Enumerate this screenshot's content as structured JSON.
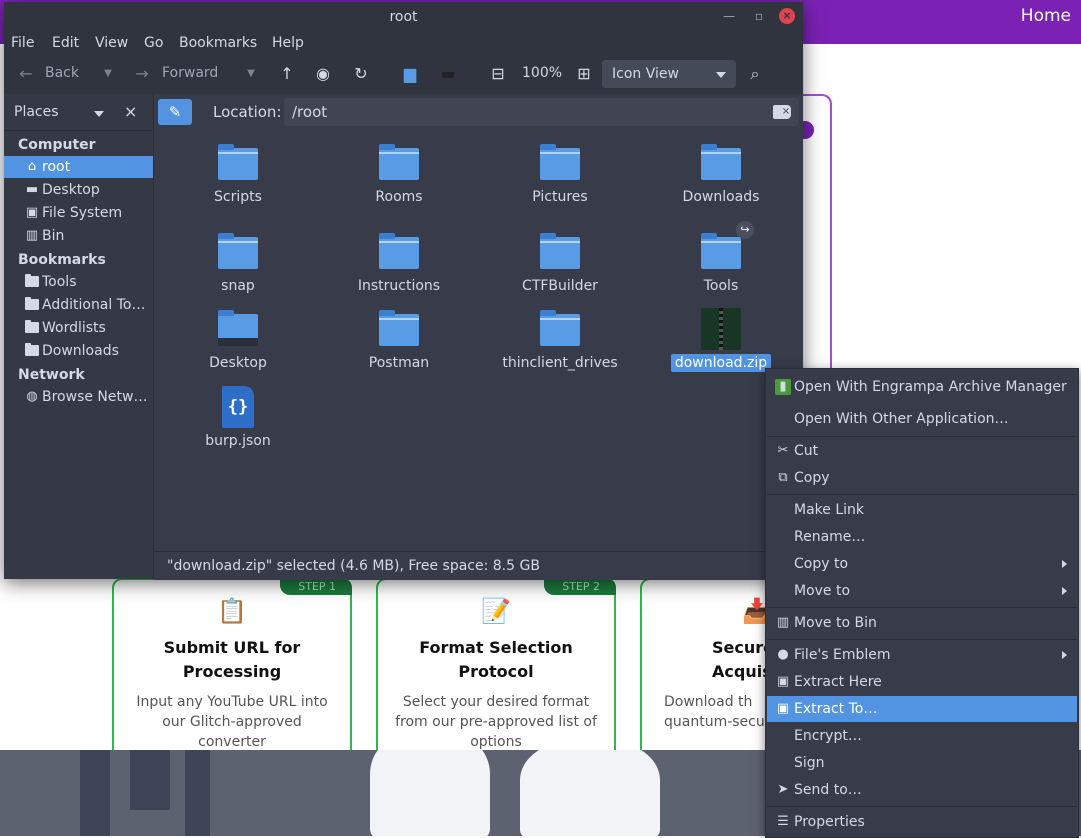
{
  "background": {
    "nav_link": "Home",
    "steps": [
      {
        "badge": "STEP 1",
        "icon": "clipboard-icon",
        "title": "Submit URL for Processing",
        "desc": "Input any YouTube URL into our Glitch-approved converter"
      },
      {
        "badge": "STEP 2",
        "icon": "memo-icon",
        "title": "Format Selection Protocol",
        "desc": "Select your desired format from our pre-approved list of options"
      },
      {
        "badge": "",
        "icon": "download-tray-icon",
        "title": "Secure Acquis",
        "desc": "Download th quantum-secu"
      }
    ]
  },
  "window": {
    "title": "root",
    "menu": [
      "File",
      "Edit",
      "View",
      "Go",
      "Bookmarks",
      "Help"
    ]
  },
  "toolbar": {
    "back": "Back",
    "forward": "Forward",
    "zoom": "100%",
    "view_mode": "Icon View"
  },
  "sidebar": {
    "header": "Places",
    "categories": {
      "computer": "Computer",
      "bookmarks": "Bookmarks",
      "network": "Network"
    },
    "computer_items": [
      {
        "label": "root",
        "icon": "home-icon"
      },
      {
        "label": "Desktop",
        "icon": "desktop-icon"
      },
      {
        "label": "File System",
        "icon": "drive-icon"
      },
      {
        "label": "Bin",
        "icon": "trash-icon"
      }
    ],
    "bookmark_items": [
      {
        "label": "Tools",
        "icon": "folder-icon"
      },
      {
        "label": "Additional To…",
        "icon": "folder-icon"
      },
      {
        "label": "Wordlists",
        "icon": "folder-icon"
      },
      {
        "label": "Downloads",
        "icon": "folder-icon"
      }
    ],
    "network_items": [
      {
        "label": "Browse Netw…",
        "icon": "network-icon"
      }
    ]
  },
  "location": {
    "label": "Location:",
    "path": "/root"
  },
  "files": [
    {
      "name": "Scripts",
      "type": "folder"
    },
    {
      "name": "Rooms",
      "type": "folder"
    },
    {
      "name": "Pictures",
      "type": "folder"
    },
    {
      "name": "Downloads",
      "type": "folder"
    },
    {
      "name": "snap",
      "type": "folder"
    },
    {
      "name": "Instructions",
      "type": "folder"
    },
    {
      "name": "CTFBuilder",
      "type": "folder"
    },
    {
      "name": "Tools",
      "type": "folder-link"
    },
    {
      "name": "Desktop",
      "type": "desktop-folder"
    },
    {
      "name": "Postman",
      "type": "folder"
    },
    {
      "name": "thinclient_drives",
      "type": "folder"
    },
    {
      "name": "download.zip",
      "type": "zip",
      "selected": true
    },
    {
      "name": "burp.json",
      "type": "json"
    }
  ],
  "status": "\"download.zip\" selected (4.6 MB), Free space: 8.5 GB",
  "context_menu": {
    "items": [
      {
        "label": "Open With Engrampa Archive Manager",
        "icon": "engrampa-icon"
      },
      {
        "label": "Open With Other Application…",
        "icon": ""
      },
      {
        "label": "Cut",
        "icon": "scissors-icon"
      },
      {
        "label": "Copy",
        "icon": "copy-icon"
      },
      {
        "label": "Make Link",
        "icon": ""
      },
      {
        "label": "Rename…",
        "icon": ""
      },
      {
        "label": "Copy to",
        "icon": "",
        "submenu": true
      },
      {
        "label": "Move to",
        "icon": "",
        "submenu": true
      },
      {
        "label": "Move to Bin",
        "icon": "trash-icon"
      },
      {
        "label": "File's Emblem",
        "icon": "emblem-drop-icon",
        "submenu": true
      },
      {
        "label": "Extract Here",
        "icon": "archive-extract-icon"
      },
      {
        "label": "Extract To…",
        "icon": "archive-extract-icon",
        "highlighted": true
      },
      {
        "label": "Encrypt…",
        "icon": ""
      },
      {
        "label": "Sign",
        "icon": ""
      },
      {
        "label": "Send to…",
        "icon": "send-icon"
      },
      {
        "label": "Properties",
        "icon": "properties-icon"
      }
    ]
  },
  "colors": {
    "accent": "#5294e2",
    "window_bg": "#383c4a",
    "header_bg": "#2f343f",
    "folder": "#5a9be6",
    "web_purple": "#7b22b5",
    "step_green": "#2db94d",
    "close_button": "#e0424f"
  }
}
